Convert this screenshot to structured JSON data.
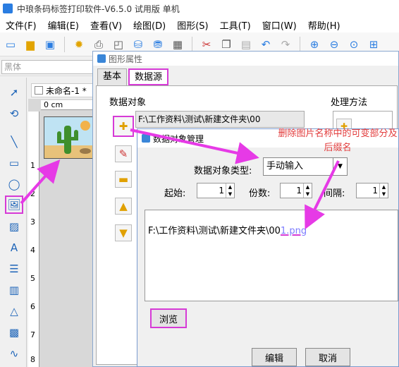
{
  "app": {
    "title": "中琅条码标签打印软件-V6.5.0 试用版 单机"
  },
  "menu": [
    {
      "label": "文件(F)"
    },
    {
      "label": "编辑(E)"
    },
    {
      "label": "查看(V)"
    },
    {
      "label": "绘图(D)"
    },
    {
      "label": "图形(S)"
    },
    {
      "label": "工具(T)"
    },
    {
      "label": "窗口(W)"
    },
    {
      "label": "帮助(H)"
    }
  ],
  "toolbar_icons": [
    "new-icon",
    "open-icon",
    "save-icon",
    "settings-icon",
    "print-icon",
    "preview-icon",
    "database-icon",
    "db-connect-icon",
    "grid-icon",
    "cut-icon",
    "copy-icon",
    "paste-icon",
    "undo-icon",
    "redo-icon",
    "zoom-in-icon",
    "zoom-out-icon",
    "zoom-fit-icon",
    "fit-page-icon"
  ],
  "font_box": "黑体",
  "palette_icons": [
    "pointer-icon",
    "rotate-icon",
    "line-icon",
    "rectangle-icon",
    "ellipse-icon",
    "image-icon",
    "image-icon-2",
    "text-icon",
    "rich-text-icon",
    "barcode-icon",
    "shape-icon",
    "qrcode-icon",
    "curve-icon"
  ],
  "document": {
    "tab": "未命名-1 *",
    "ruler_top": "0 cm",
    "ruler_left": [
      "1",
      "2",
      "3",
      "4",
      "5",
      "6",
      "7",
      "8"
    ]
  },
  "props_dialog": {
    "title": "图形属性",
    "tabs": [
      "基本",
      "数据源"
    ],
    "data_object_label": "数据对象",
    "method_label": "处理方法",
    "data_object_value": "F:\\工作资料\\测试\\新建文件夹\\00"
  },
  "manager": {
    "title": "数据对象管理",
    "type_label": "数据对象类型:",
    "type_value": "手动输入",
    "start_label": "起始:",
    "start_value": "1",
    "copies_label": "份数:",
    "copies_value": "1",
    "interval_label": "间隔:",
    "interval_value": "1",
    "content_prefix": "F:\\工作资料\\测试\\新建文件夹\\00",
    "content_suffix": "1.png",
    "browse_label": "浏览",
    "edit_label": "编辑",
    "cancel_label": "取消"
  },
  "annotation": "删除图片名称中的可变部分及后缀名",
  "colors": {
    "highlight": "#d63ad6",
    "annotation": "#e23b3b",
    "accent": "#2a7de1"
  }
}
